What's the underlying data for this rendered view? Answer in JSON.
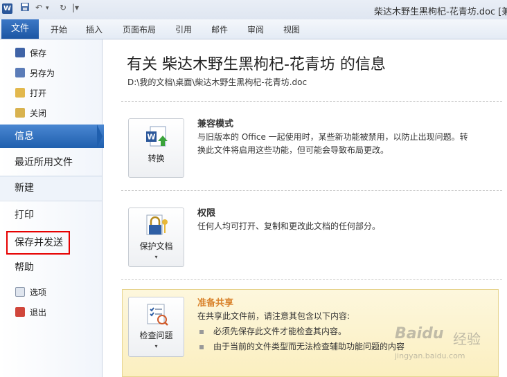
{
  "window": {
    "title": "柴达木野生黑枸杞-花青坊.doc [兼"
  },
  "quick_access": {
    "app_icon": "W",
    "save_icon": "save-icon",
    "undo": "↶",
    "undo_drop": "▾",
    "redo": "↻",
    "more": "|▾"
  },
  "ribbon": {
    "file_tab": "文件",
    "tabs": [
      "开始",
      "插入",
      "页面布局",
      "引用",
      "邮件",
      "审阅",
      "视图"
    ]
  },
  "sidebar": {
    "small_top": [
      "保存",
      "另存为",
      "打开",
      "关闭"
    ],
    "info": "信息",
    "recent": "最近所用文件",
    "new": "新建",
    "print": "打印",
    "save_send": "保存并发送",
    "help": "帮助",
    "small_bottom": [
      "选项",
      "退出"
    ]
  },
  "main": {
    "title": "有关 柴达木野生黑枸杞-花青坊 的信息",
    "path": "D:\\我的文档\\桌面\\柴达木野生黑枸杞-花青坊.doc",
    "compat": {
      "button": "转换",
      "title": "兼容模式",
      "line1": "与旧版本的 Office 一起使用时，某些新功能被禁用，以防止出现问题。转",
      "line2": "换此文件将启用这些功能，但可能会导致布局更改。"
    },
    "permissions": {
      "button": "保护文档",
      "dropdown": "▾",
      "title": "权限",
      "text": "任何人均可打开、复制和更改此文档的任何部分。"
    },
    "share": {
      "button": "检查问题",
      "dropdown": "▾",
      "title": "准备共享",
      "text": "在共享此文件前，请注意其包含以下内容:",
      "bullets": [
        "必须先保存此文件才能检查其内容。",
        "由于当前的文件类型而无法检查辅助功能问题的内容"
      ]
    }
  },
  "watermark": {
    "text1": "Baidu",
    "text2": "经验",
    "text3": "jingyan.baidu.com"
  },
  "colors": {
    "file_tab": "#2a64b3",
    "active_nav": "#2f6fc0",
    "highlight_box": "#e60000",
    "share_bg": "#fcf3cc",
    "share_title": "#d9822b"
  }
}
